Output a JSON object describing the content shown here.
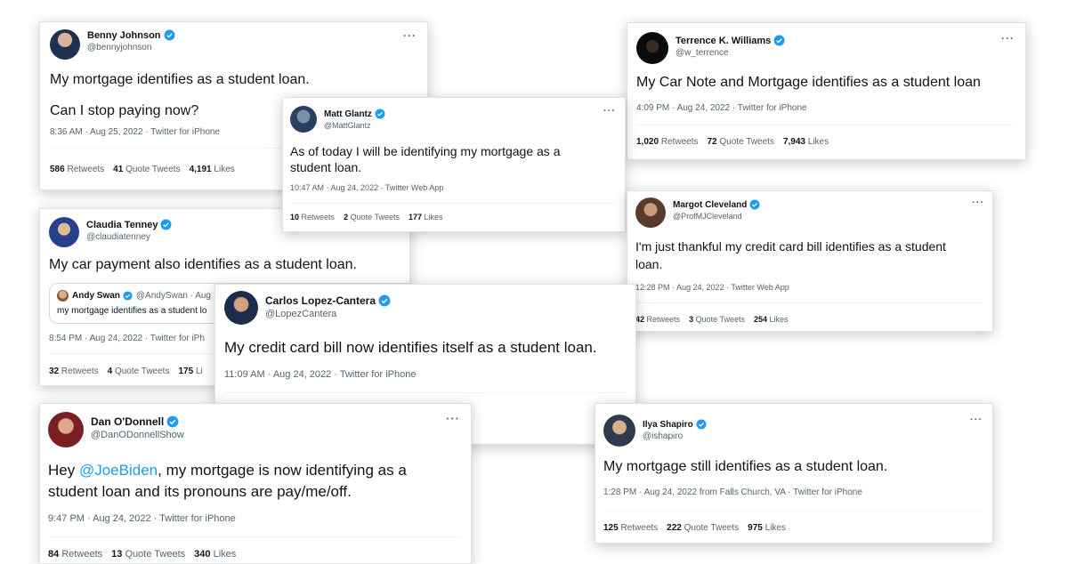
{
  "colors": {
    "verified": "#1d9bf0",
    "link": "#1d9bf0",
    "secondary": "#536471",
    "text": "#0f1419"
  },
  "tweets": {
    "benny": {
      "name": "Benny Johnson",
      "handle": "@bennyjohnson",
      "line1": "My mortgage identifies as a student loan.",
      "line2": "Can I stop paying now?",
      "meta": "8:36 AM · Aug 25, 2022 · Twitter for iPhone",
      "retweets": "586",
      "retweets_label": "Retweets",
      "quotes": "41",
      "quotes_label": "Quote Tweets",
      "likes": "4,191",
      "likes_label": "Likes"
    },
    "matt": {
      "name": "Matt Glantz",
      "handle": "@MattGlantz",
      "text": "As of today I will be identifying my mortgage as a student loan.",
      "meta": "10:47 AM · Aug 24, 2022 · Twitter Web App",
      "retweets": "10",
      "retweets_label": "Retweets",
      "quotes": "2",
      "quotes_label": "Quote Tweets",
      "likes": "177",
      "likes_label": "Likes"
    },
    "terrence": {
      "name": "Terrence K. Williams",
      "handle": "@w_terrence",
      "text": "My Car Note and Mortgage identifies as a student loan",
      "meta": "4:09 PM · Aug 24, 2022 · Twitter for iPhone",
      "retweets": "1,020",
      "retweets_label": "Retweets",
      "quotes": "72",
      "quotes_label": "Quote Tweets",
      "likes": "7,943",
      "likes_label": "Likes"
    },
    "claudia": {
      "name": "Claudia Tenney",
      "handle": "@claudiatenney",
      "text": "My car payment also identifies as a student loan.",
      "quote_name": "Andy Swan",
      "quote_handle": "@AndySwan · Aug",
      "quote_text": "my mortgage identifies as a student lo",
      "meta": "8:54 PM · Aug 24, 2022 · Twitter for iPh",
      "retweets": "32",
      "retweets_label": "Retweets",
      "quotes": "4",
      "quotes_label": "Quote Tweets",
      "likes": "175",
      "likes_label": "Li"
    },
    "margot": {
      "name": "Margot Cleveland",
      "handle": "@ProfMJCleveland",
      "text": "I'm just thankful my credit card bill identifies as a student loan.",
      "meta": "12:28 PM · Aug 24, 2022 · Twitter Web App",
      "retweets": "42",
      "retweets_label": "Retweets",
      "quotes": "3",
      "quotes_label": "Quote Tweets",
      "likes": "254",
      "likes_label": "Likes"
    },
    "carlos": {
      "name": "Carlos Lopez-Cantera",
      "handle": "@LopezCantera",
      "text": "My credit card bill now identifies itself as a student loan.",
      "meta": "11:09 AM · Aug 24, 2022 · Twitter for iPhone"
    },
    "dan": {
      "name": "Dan O'Donnell",
      "handle": "@DanODonnellShow",
      "text_pre": "Hey ",
      "mention": "@JoeBiden",
      "text_post": ", my mortgage is now identifying as a student loan and its pronouns are pay/me/off.",
      "meta": "9:47 PM · Aug 24, 2022 · Twitter for iPhone",
      "retweets": "84",
      "retweets_label": "Retweets",
      "quotes": "13",
      "quotes_label": "Quote Tweets",
      "likes": "340",
      "likes_label": "Likes"
    },
    "ilya": {
      "name": "Ilya Shapiro",
      "handle": "@ishapiro",
      "text": "My mortgage still identifies as a student loan.",
      "meta": "1:28 PM · Aug 24, 2022 from Falls Church, VA · Twitter for iPhone",
      "retweets": "125",
      "retweets_label": "Retweets",
      "quotes": "222",
      "quotes_label": "Quote Tweets",
      "likes": "975",
      "likes_label": "Likes"
    }
  },
  "more_glyph": "···"
}
